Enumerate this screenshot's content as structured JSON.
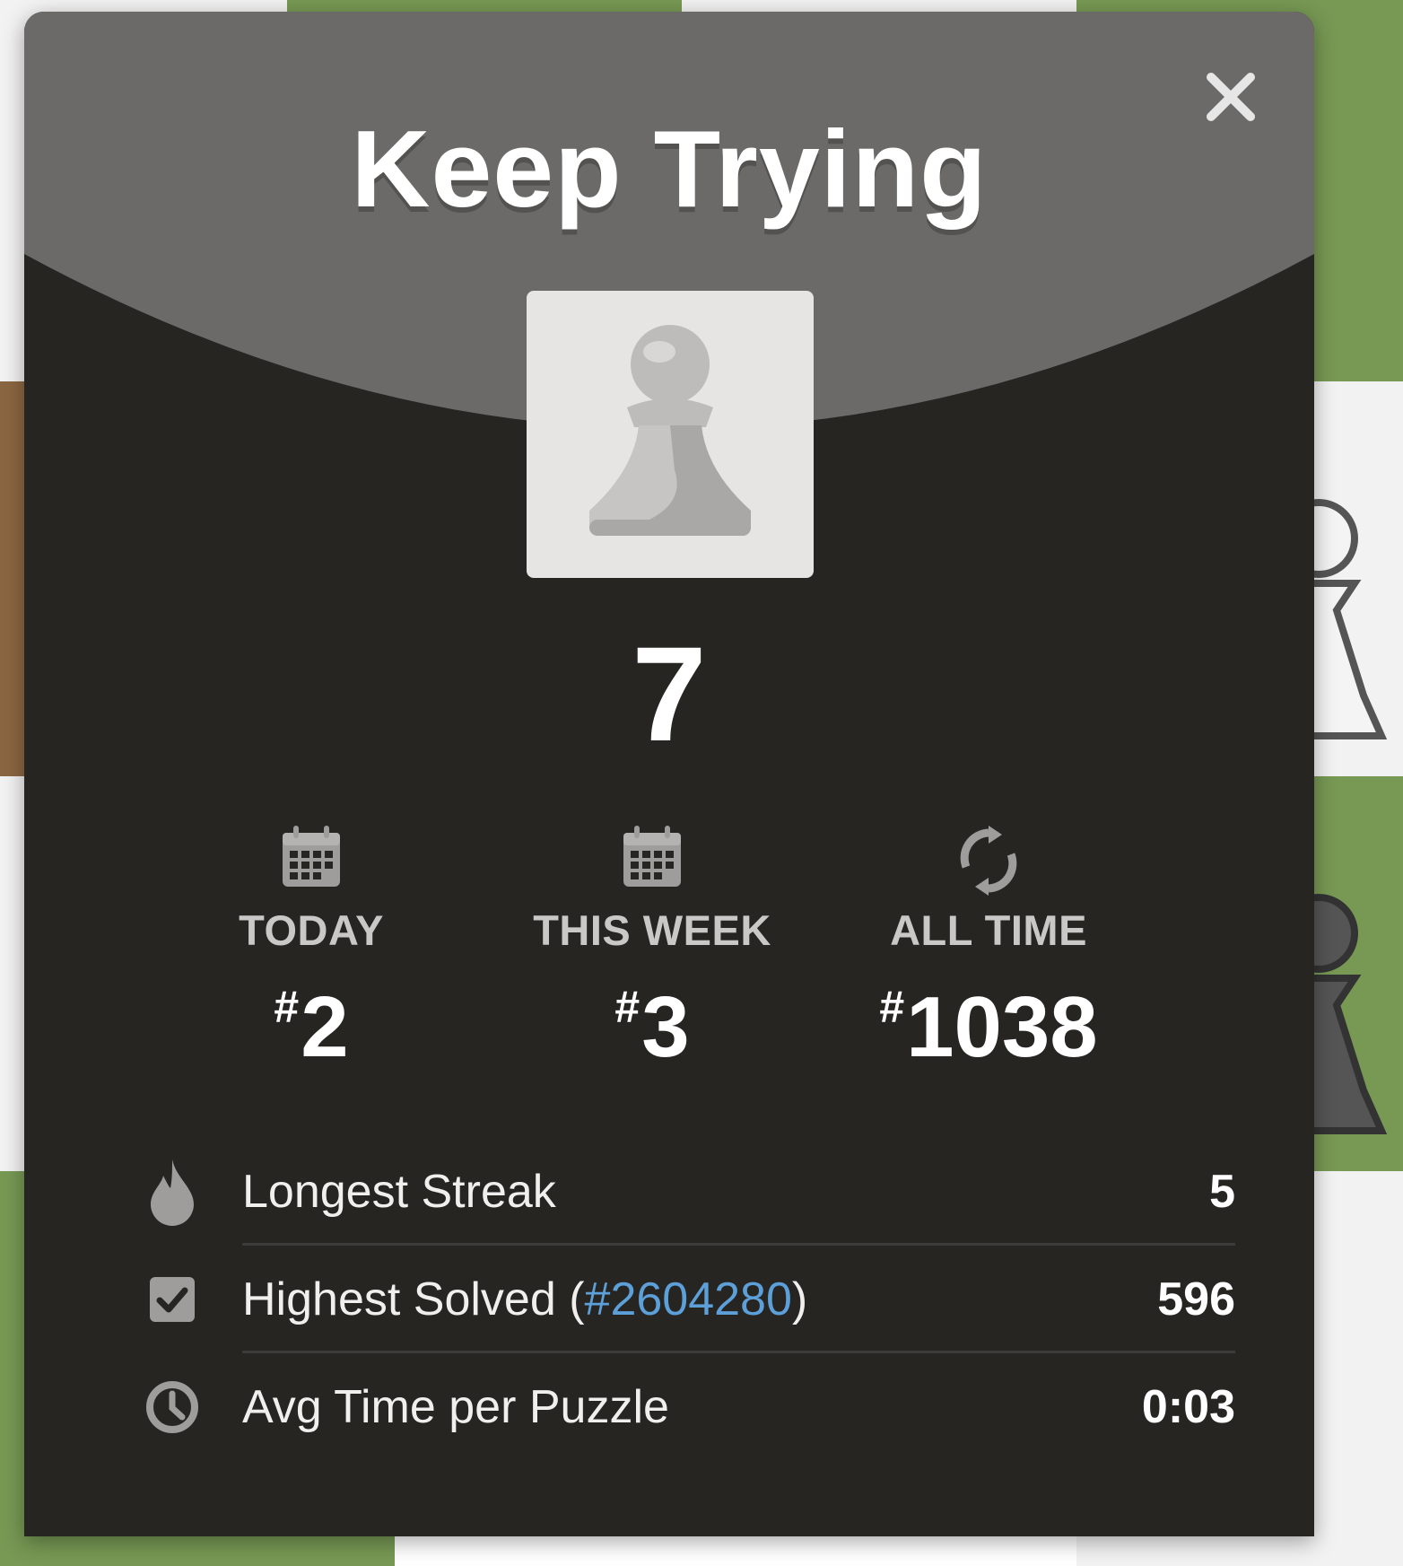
{
  "modal": {
    "title": "Keep Trying",
    "score": "7",
    "avatar_icon": "pawn-icon",
    "close_icon": "close-icon"
  },
  "ranks": [
    {
      "icon": "calendar-icon",
      "label": "TODAY",
      "hash": "#",
      "value": "2"
    },
    {
      "icon": "calendar-icon",
      "label": "THIS WEEK",
      "hash": "#",
      "value": "3"
    },
    {
      "icon": "refresh-icon",
      "label": "ALL TIME",
      "hash": "#",
      "value": "1038"
    }
  ],
  "stats": [
    {
      "icon": "flame-icon",
      "label": "Longest Streak",
      "value": "5"
    },
    {
      "icon": "checkbox-icon",
      "label_prefix": "Highest Solved (",
      "link": "#2604280",
      "label_suffix": ")",
      "value": "596"
    },
    {
      "icon": "clock-icon",
      "label": "Avg Time per Puzzle",
      "value": "0:03"
    }
  ],
  "colors": {
    "modal_bg": "#262522",
    "header_bg": "#6b6a68",
    "link": "#5d9fd8",
    "board_light": "#ebecd0",
    "board_dark": "#779954"
  }
}
